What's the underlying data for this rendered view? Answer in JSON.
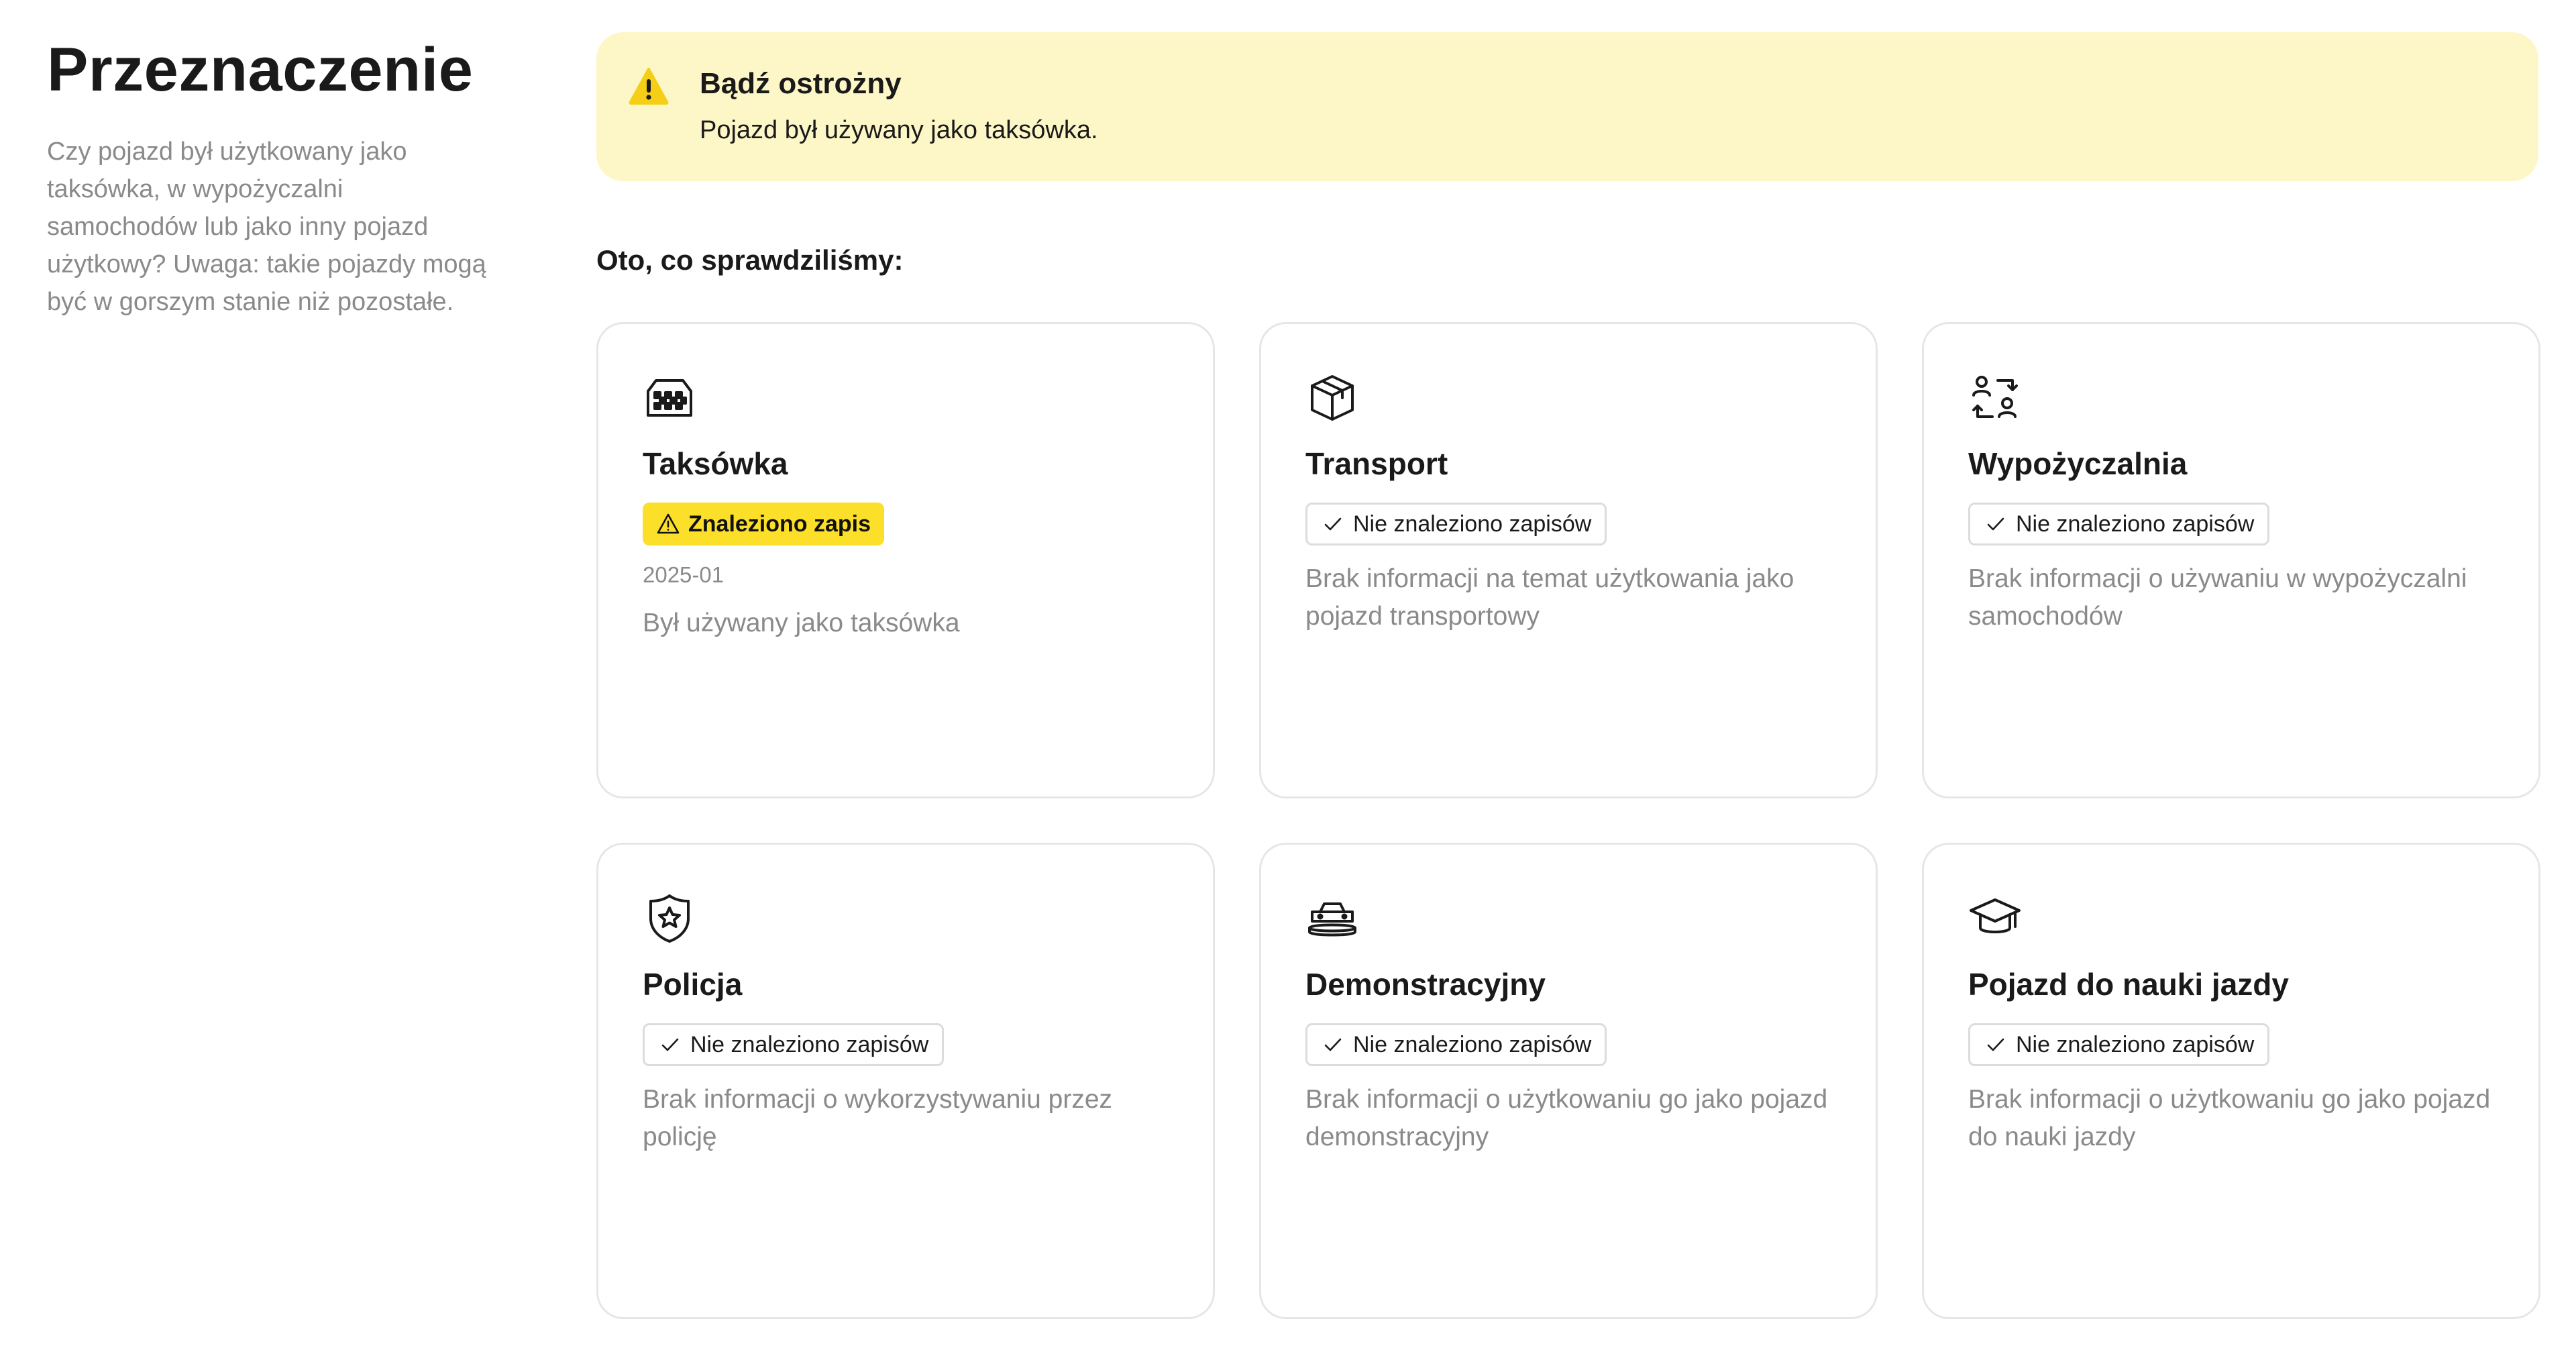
{
  "sidebar": {
    "title": "Przeznaczenie",
    "description": "Czy pojazd był użytkowany jako taksówka, w wypożyczalni samochodów lub jako inny pojazd użytkowy? Uwaga: takie pojazdy mogą być w gorszym stanie niż pozostałe."
  },
  "alert": {
    "icon": "warning-icon",
    "title": "Bądź ostrożny",
    "text": "Pojazd był używany jako taksówka.",
    "background": "#fdf6c6",
    "icon_color": "#f5cf17"
  },
  "checked_heading": "Oto, co sprawdziliśmy:",
  "colors": {
    "found_badge": "#fcdf28",
    "muted_text": "#8a8a8a",
    "card_border": "#e6e6e6"
  },
  "cards": [
    {
      "icon": "taxi-icon",
      "title": "Taksówka",
      "status": "Znaleziono zapis",
      "status_icon": "warning-icon",
      "date": "2025-01",
      "description": "Był używany jako taksówka"
    },
    {
      "icon": "box-icon",
      "title": "Transport",
      "status": "Nie znaleziono zapisów",
      "status_icon": "check-icon",
      "description": "Brak informacji na temat użytkowania jako pojazd transportowy"
    },
    {
      "icon": "rental-swap-icon",
      "title": "Wypożyczalnia",
      "status": "Nie znaleziono zapisów",
      "status_icon": "check-icon",
      "description": "Brak informacji o używaniu w wypożyczalni samochodów"
    },
    {
      "icon": "police-badge-icon",
      "title": "Policja",
      "status": "Nie znaleziono zapisów",
      "status_icon": "check-icon",
      "description": "Brak informacji o wykorzystywaniu przez policję"
    },
    {
      "icon": "car-display-icon",
      "title": "Demonstracyjny",
      "status": "Nie znaleziono zapisów",
      "status_icon": "check-icon",
      "description": "Brak informacji o użytkowaniu go jako pojazd demonstracyjny"
    },
    {
      "icon": "graduation-cap-icon",
      "title": "Pojazd do nauki jazdy",
      "status": "Nie znaleziono zapisów",
      "status_icon": "check-icon",
      "description": "Brak informacji o użytkowaniu go jako pojazd do nauki jazdy"
    }
  ]
}
